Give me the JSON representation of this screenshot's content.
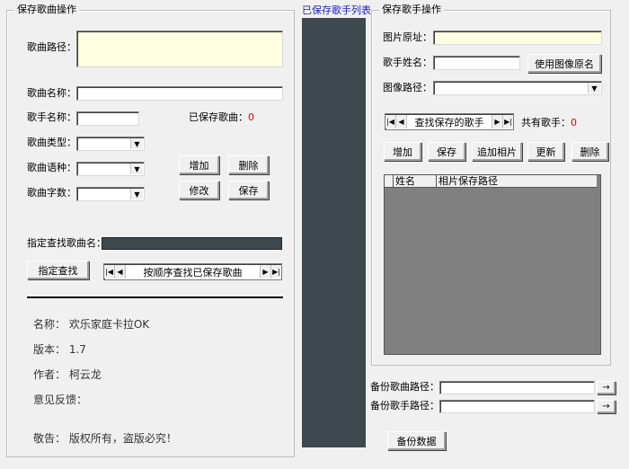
{
  "song_panel": {
    "title": "保存歌曲操作",
    "path_label": "歌曲路径：",
    "name_label": "歌曲名称：",
    "singer_label": "歌手名称：",
    "saved_label": "已保存歌曲：",
    "saved_count": "0",
    "type_label": "歌曲类型：",
    "lang_label": "歌曲语种：",
    "words_label": "歌曲字数：",
    "add_btn": "增加",
    "delete_btn": "删除",
    "edit_btn": "修改",
    "save_btn": "保存",
    "search_label": "指定查找歌曲名：",
    "search_btn": "指定查找",
    "nav_text": "按顺序查找已保存歌曲"
  },
  "info": {
    "name": "名称：  欢乐家庭卡拉OK",
    "version": "版本：  1.7",
    "author": "作者：  柯云龙",
    "feedback": "意见反馈：",
    "notice": "敬告：  版权所有，盗版必究！"
  },
  "middle": {
    "title": "已保存歌手列表"
  },
  "singer_panel": {
    "title": "保存歌手操作",
    "photo_label": "图片原址：",
    "name_label": "歌手姓名：",
    "use_name_btn": "使用图像原名",
    "image_path_label": "图像路径：",
    "nav_text": "查找保存的歌手",
    "total_label": "共有歌手：",
    "total_count": "0",
    "add_btn": "增加",
    "save_btn": "保存",
    "add_photo_btn": "追加相片",
    "refresh_btn": "更新",
    "delete_btn": "删除",
    "col_name": "姓名",
    "col_path": "相片保存路径"
  },
  "backup": {
    "song_label": "备份歌曲路径：",
    "singer_label": "备份歌手路径：",
    "browse": "→",
    "btn": "备份数据"
  },
  "colors": {
    "panel_dark": "#3e484f",
    "grid_bg": "#808080",
    "yellow_input": "#ffffe1",
    "count_red": "#e00000",
    "list_title_blue": "#2020c0"
  }
}
